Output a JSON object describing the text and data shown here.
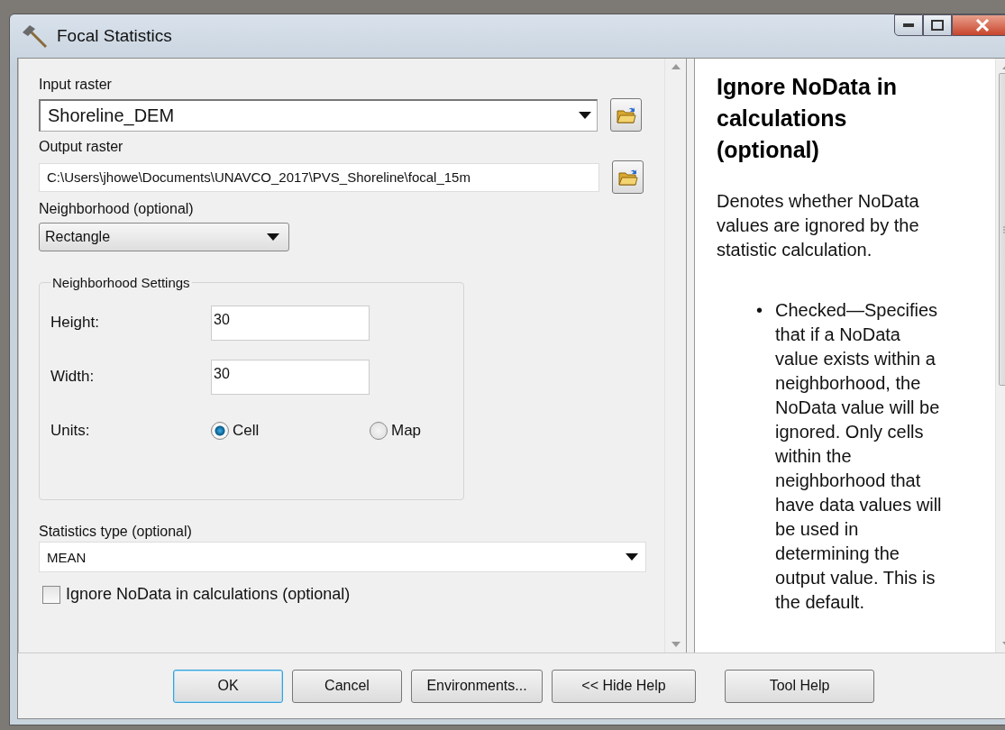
{
  "window": {
    "title": "Focal Statistics"
  },
  "input_raster": {
    "label": "Input raster",
    "value": "Shoreline_DEM"
  },
  "output_raster": {
    "label": "Output raster",
    "value": "C:\\Users\\jhowe\\Documents\\UNAVCO_2017\\PVS_Shoreline\\focal_15m"
  },
  "neighborhood": {
    "label": "Neighborhood (optional)",
    "value": "Rectangle"
  },
  "neighborhood_settings": {
    "title": "Neighborhood Settings",
    "height": {
      "label": "Height:",
      "value": "30"
    },
    "width": {
      "label": "Width:",
      "value": "30"
    },
    "units": {
      "label": "Units:",
      "options": [
        {
          "label": "Cell",
          "selected": true
        },
        {
          "label": "Map",
          "selected": false
        }
      ]
    }
  },
  "statistics_type": {
    "label": "Statistics type (optional)",
    "value": "MEAN"
  },
  "ignore_nodata": {
    "label": "Ignore NoData in calculations (optional)",
    "checked": false
  },
  "help": {
    "title": "Ignore NoData in calculations (optional)",
    "description": "Denotes whether NoData values are ignored by the statistic calculation.",
    "bullets": [
      {
        "marker": "•",
        "text": "Checked—Specifies that if a NoData value exists within a neighborhood, the NoData value will be ignored. Only cells within the neighborhood that have data values will be used in determining the output value. This is the default."
      }
    ]
  },
  "buttons": [
    {
      "label": "OK",
      "focused": true
    },
    {
      "label": "Cancel",
      "focused": false
    },
    {
      "label": "Environments...",
      "focused": false
    },
    {
      "label": "<< Hide Help",
      "focused": false
    },
    {
      "label": "Tool Help",
      "focused": false
    }
  ]
}
